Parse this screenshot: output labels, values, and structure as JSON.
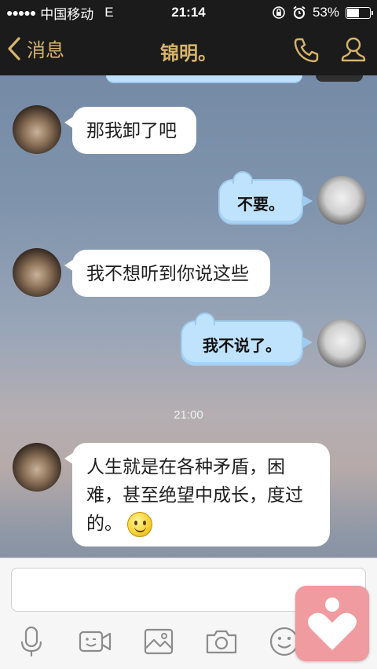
{
  "status_bar": {
    "signal_dots": "●●●●●",
    "carrier": "中国移动",
    "network": "E",
    "time": "21:14",
    "battery": "53%",
    "battery_level": 0.53
  },
  "nav": {
    "back_label": "消息",
    "title": "锦明。",
    "accent": "#d7b46a"
  },
  "messages": [
    {
      "from": "him",
      "text": "那我卸了吧"
    },
    {
      "from": "me",
      "text": "不要。"
    },
    {
      "from": "him",
      "text": "我不想听到你说这些"
    },
    {
      "from": "me",
      "text": "我不说了。"
    },
    {
      "from": "him",
      "text": "人生就是在各种矛盾，困难，甚至绝望中成长，度过的。",
      "emoji": "smiley"
    }
  ],
  "timestamp": "21:00",
  "toolbar": {
    "icons": [
      "microphone-icon",
      "video-call-icon",
      "image-icon",
      "camera-icon",
      "emoji-icon"
    ]
  }
}
